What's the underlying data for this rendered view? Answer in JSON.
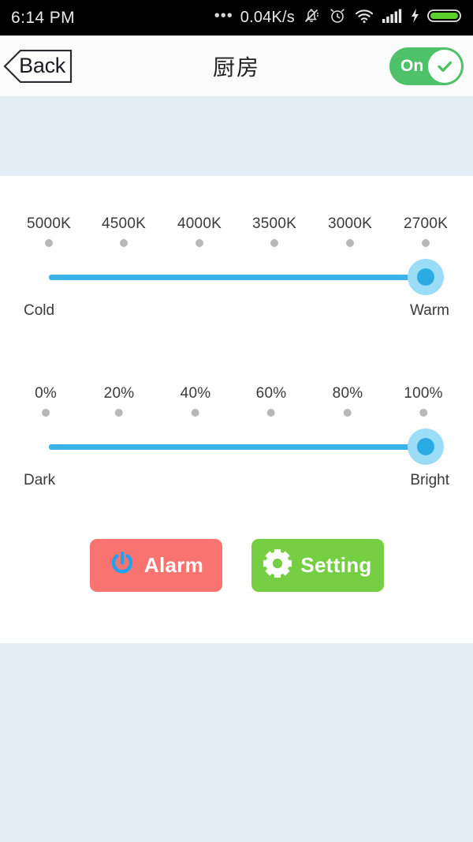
{
  "status_bar": {
    "time": "6:14 PM",
    "dots": "•••",
    "network_speed": "0.04K/s",
    "icons": [
      "bell-muted-icon",
      "alarm-clock-icon",
      "wifi-icon",
      "cellular-signal-icon",
      "charging-bolt-icon",
      "battery-icon"
    ]
  },
  "header": {
    "back_label": "Back",
    "title": "厨房",
    "toggle_label": "On",
    "toggle_state": "on",
    "toggle_color": "#4ec16a"
  },
  "color_temperature_slider": {
    "ticks": [
      "5000K",
      "4500K",
      "4000K",
      "3500K",
      "3000K",
      "2700K"
    ],
    "left_endcap": "Cold",
    "right_endcap": "Warm",
    "value": "2700K",
    "value_index": 5,
    "track_color": "#3cb3e8",
    "thumb_color": "#9bdcf6"
  },
  "brightness_slider": {
    "ticks": [
      "0%",
      "20%",
      "40%",
      "60%",
      "80%",
      "100%"
    ],
    "left_endcap": "Dark",
    "right_endcap": "Bright",
    "value": "100%",
    "value_index": 5,
    "track_color": "#3cb3e8",
    "thumb_color": "#9bdcf6"
  },
  "actions": {
    "alarm": {
      "label": "Alarm",
      "icon": "power-icon",
      "bg": "#f97470",
      "icon_color": "#1fa2f0"
    },
    "setting": {
      "label": "Setting",
      "icon": "gear-icon",
      "bg": "#76cf43",
      "icon_color": "#ffffff"
    }
  },
  "theme": {
    "page_bg": "#e3eef5",
    "panel_bg": "#ffffff",
    "header_bg": "#fbfbfb"
  }
}
